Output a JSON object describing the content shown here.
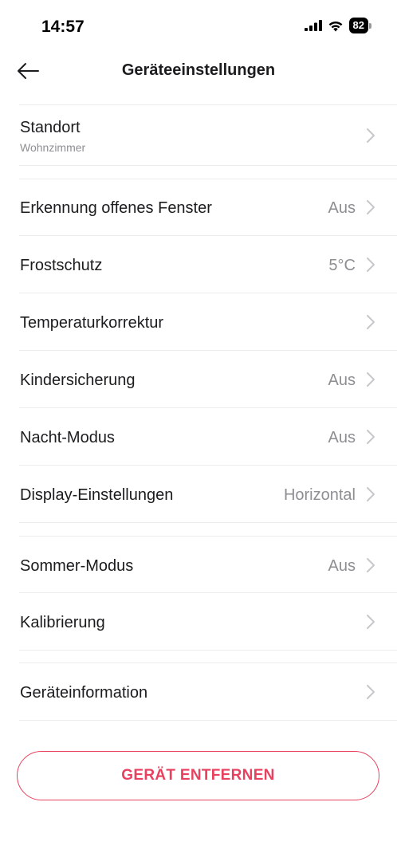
{
  "status_bar": {
    "time": "14:57",
    "battery": "82"
  },
  "header": {
    "title": "Geräteeinstellungen"
  },
  "settings": [
    {
      "label": "Standort",
      "sub": "Wohnzimmer",
      "value": ""
    },
    {
      "label": "Erkennung offenes Fenster",
      "value": "Aus"
    },
    {
      "label": "Frostschutz",
      "value": "5°C"
    },
    {
      "label": "Temperaturkorrektur",
      "value": ""
    },
    {
      "label": "Kindersicherung",
      "value": "Aus"
    },
    {
      "label": "Nacht-Modus",
      "value": "Aus"
    },
    {
      "label": "Display-Einstellungen",
      "value": "Horizontal"
    },
    {
      "label": "Sommer-Modus",
      "value": "Aus"
    },
    {
      "label": "Kalibrierung",
      "value": ""
    },
    {
      "label": "Geräteinformation",
      "value": ""
    }
  ],
  "remove_button": {
    "label": "GERÄT ENTFERNEN"
  },
  "colors": {
    "accent": "#e8415f",
    "secondary_text": "#8e8e93",
    "chevron": "#c7c7cc"
  },
  "icons": {
    "back": "arrow-left-icon",
    "row_chevron": "chevron-right-icon"
  }
}
